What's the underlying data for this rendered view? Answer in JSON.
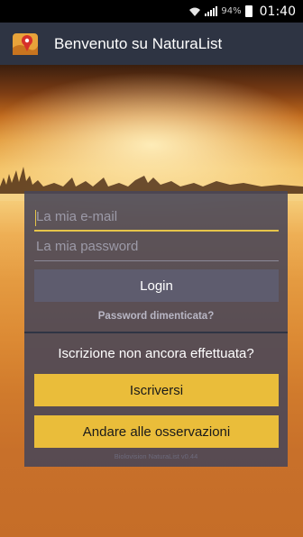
{
  "status_bar": {
    "battery_percent": "94%",
    "time": "01:40",
    "icons": [
      "wifi-icon",
      "signal-icon",
      "battery-icon"
    ]
  },
  "action_bar": {
    "title": "Benvenuto su NaturaList",
    "icon": "naturalist-logo-icon"
  },
  "login": {
    "email_placeholder": "La mia e-mail",
    "email_value": "",
    "password_placeholder": "La mia password",
    "password_value": "",
    "login_label": "Login",
    "forgot_password": "Password dimenticata?"
  },
  "register": {
    "prompt": "Iscrizione non ancora effettuata?",
    "register_label": "Iscriversi",
    "observations_label": "Andare alle osservazioni"
  },
  "footer": {
    "version": "Biolovision NaturaList v0.44"
  },
  "colors": {
    "accent": "#eabd3a",
    "action_bar": "#2e3443",
    "panel": "#484658"
  }
}
